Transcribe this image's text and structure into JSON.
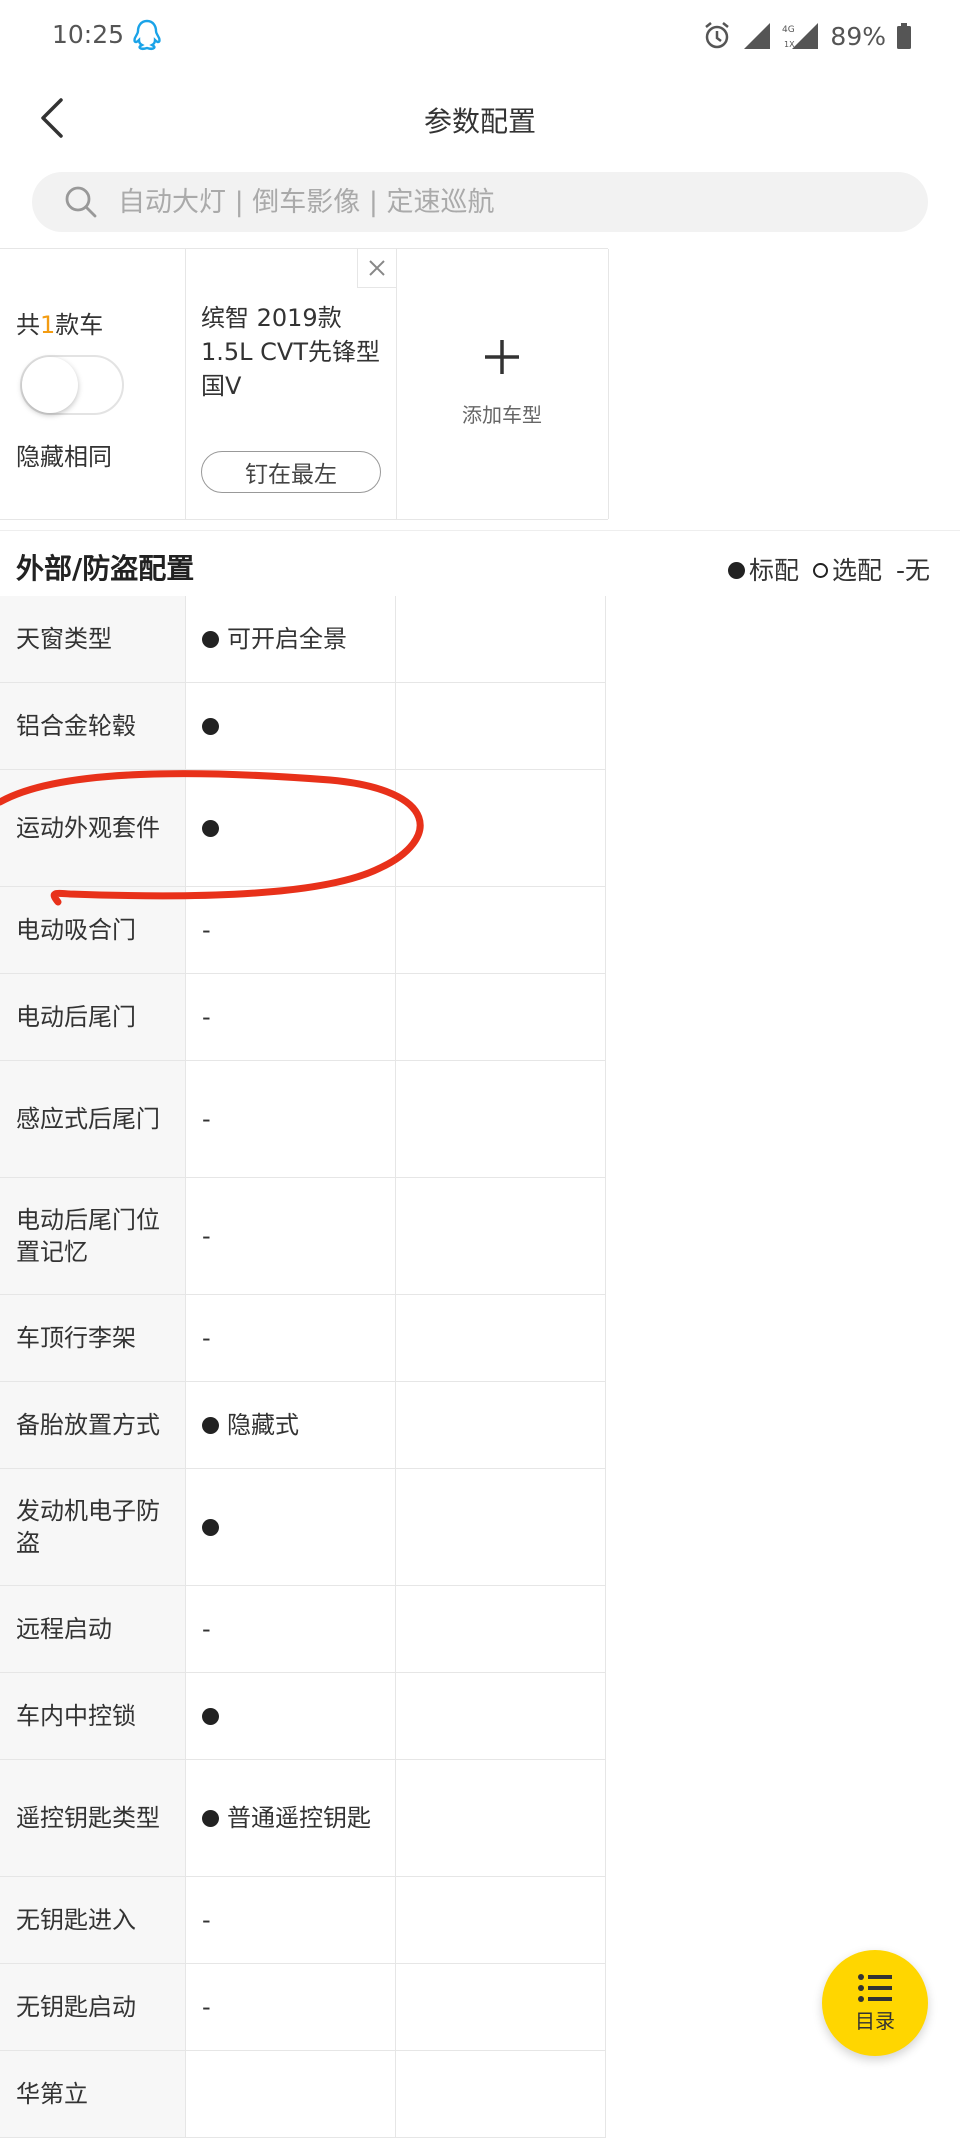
{
  "status_bar": {
    "time": "10:25",
    "battery": "89%",
    "icons": [
      "qq-icon",
      "alarm-icon",
      "signal-icon",
      "signal-4g-icon",
      "battery-icon"
    ]
  },
  "header": {
    "title": "参数配置"
  },
  "search": {
    "placeholder": "自动大灯 | 倒车影像 | 定速巡航"
  },
  "summary": {
    "count_prefix": "共",
    "count_num": "1",
    "count_suffix": "款车",
    "hide_same_label": "隐藏相同",
    "hide_same_on": false
  },
  "car": {
    "name": "缤智 2019款 1.5L CVT先锋型 国V",
    "pin_label": "钉在最左"
  },
  "add_car": {
    "label": "添加车型"
  },
  "section": {
    "title": "外部/防盗配置",
    "legend_standard": "标配",
    "legend_optional": "选配",
    "legend_none": "-无"
  },
  "rows": [
    {
      "name": "天窗类型",
      "dot": true,
      "value": "可开启全景"
    },
    {
      "name": "铝合金轮毂",
      "dot": true,
      "value": ""
    },
    {
      "name": "运动外观套件",
      "dot": true,
      "value": ""
    },
    {
      "name": "电动吸合门",
      "dot": false,
      "value": "-"
    },
    {
      "name": "电动后尾门",
      "dot": false,
      "value": "-"
    },
    {
      "name": "感应式后尾门",
      "dot": false,
      "value": "-"
    },
    {
      "name": "电动后尾门位置记忆",
      "dot": false,
      "value": "-"
    },
    {
      "name": "车顶行李架",
      "dot": false,
      "value": "-"
    },
    {
      "name": "备胎放置方式",
      "dot": true,
      "value": "隐藏式"
    },
    {
      "name": "发动机电子防盗",
      "dot": true,
      "value": ""
    },
    {
      "name": "远程启动",
      "dot": false,
      "value": "-"
    },
    {
      "name": "车内中控锁",
      "dot": true,
      "value": ""
    },
    {
      "name": "遥控钥匙类型",
      "dot": true,
      "value": "普通遥控钥匙"
    },
    {
      "name": "无钥匙进入",
      "dot": false,
      "value": "-"
    },
    {
      "name": "无钥匙启动",
      "dot": false,
      "value": "-"
    },
    {
      "name": "华第立",
      "dot": false,
      "value": ""
    }
  ],
  "fab": {
    "label": "目录"
  },
  "colors": {
    "accent_orange": "#f39c12",
    "fab_yellow": "#ffd600",
    "annotation_red": "#e8311a"
  }
}
